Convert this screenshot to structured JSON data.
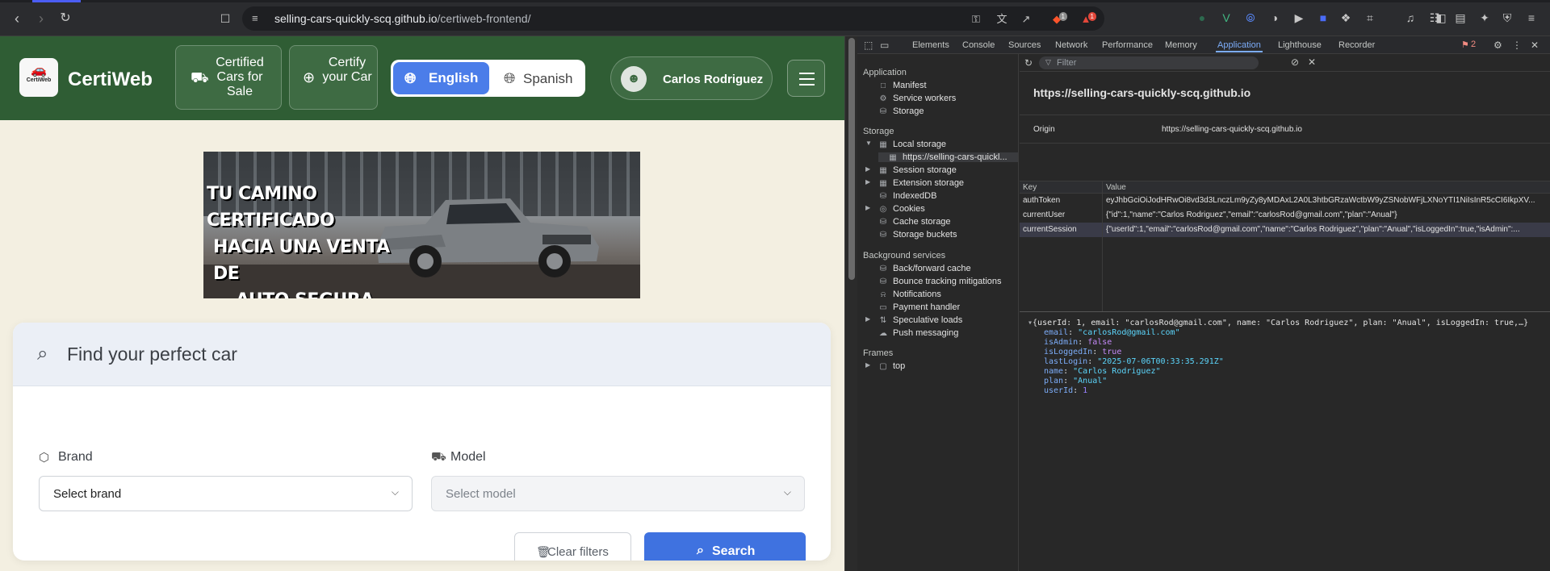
{
  "browser": {
    "url_host": "selling-cars-quickly-scq.github.io",
    "url_path": "/certiweb-frontend/",
    "brave_badge": "1",
    "alert_badge": "1"
  },
  "site": {
    "brand": "CertiWeb",
    "logo_text": "CertiWeb",
    "nav": {
      "certified_cars": "Certified Cars for Sale",
      "certify_car": "Certify your Car"
    },
    "lang": {
      "english": "English",
      "spanish": "Spanish",
      "active": "English"
    },
    "user_name": "Carlos Rodriguez",
    "banner_lines": [
      "TU CAMINO CERTIFICADO",
      "HACIA UNA VENTA DE",
      "AUTO SEGURA"
    ],
    "search": {
      "title": "Find your perfect car",
      "brand_label": "Brand",
      "brand_value": "Select brand",
      "model_label": "Model",
      "model_value": "Select model",
      "clear_label": "Clear filters",
      "search_label": "Search"
    }
  },
  "devtools": {
    "tabs": [
      "Elements",
      "Console",
      "Sources",
      "Network",
      "Performance",
      "Memory",
      "Application",
      "Lighthouse",
      "Recorder"
    ],
    "active_tab": "Application",
    "issues_count": "2",
    "sidebar": {
      "application_header": "Application",
      "application_items": [
        "Manifest",
        "Service workers",
        "Storage"
      ],
      "storage_header": "Storage",
      "storage_items": [
        "Local storage",
        "https://selling-cars-quickl...",
        "Session storage",
        "Extension storage",
        "IndexedDB",
        "Cookies",
        "Cache storage",
        "Storage buckets"
      ],
      "background_header": "Background services",
      "background_items": [
        "Back/forward cache",
        "Bounce tracking mitigations",
        "Notifications",
        "Payment handler",
        "Speculative loads",
        "Push messaging"
      ],
      "frames_header": "Frames",
      "frames_items": [
        "top"
      ]
    },
    "filter_placeholder": "Filter",
    "origin_title": "https://selling-cars-quickly-scq.github.io",
    "origin_label": "Origin",
    "origin_value": "https://selling-cars-quickly-scq.github.io",
    "table_headers": [
      "Key",
      "Value"
    ],
    "rows": [
      {
        "key": "authToken",
        "value": "eyJhbGciOiJodHRwOi8vd3d3LnczLm9yZy8yMDAxL2A0L3htbGRzaWctbW9yZSNobWFjLXNoYTI1NiIsInR5cCI6IkpXV..."
      },
      {
        "key": "currentUser",
        "value": "{\"id\":1,\"name\":\"Carlos Rodriguez\",\"email\":\"carlosRod@gmail.com\",\"plan\":\"Anual\"}"
      },
      {
        "key": "currentSession",
        "value": "{\"userId\":1,\"email\":\"carlosRod@gmail.com\",\"name\":\"Carlos Rodriguez\",\"plan\":\"Anual\",\"isLoggedIn\":true,\"isAdmin\":..."
      }
    ],
    "object_summary": "{userId: 1, email: \"carlosRod@gmail.com\", name: \"Carlos Rodriguez\", plan: \"Anual\", isLoggedIn: true,…}",
    "object_props": [
      {
        "key": "email",
        "value": "\"carlosRod@gmail.com\"",
        "kind": "str"
      },
      {
        "key": "isAdmin",
        "value": "false",
        "kind": "kw"
      },
      {
        "key": "isLoggedIn",
        "value": "true",
        "kind": "kw"
      },
      {
        "key": "lastLogin",
        "value": "\"2025-07-06T00:33:35.291Z\"",
        "kind": "str"
      },
      {
        "key": "name",
        "value": "\"Carlos Rodriguez\"",
        "kind": "str"
      },
      {
        "key": "plan",
        "value": "\"Anual\"",
        "kind": "str"
      },
      {
        "key": "userId",
        "value": "1",
        "kind": "num"
      }
    ]
  }
}
